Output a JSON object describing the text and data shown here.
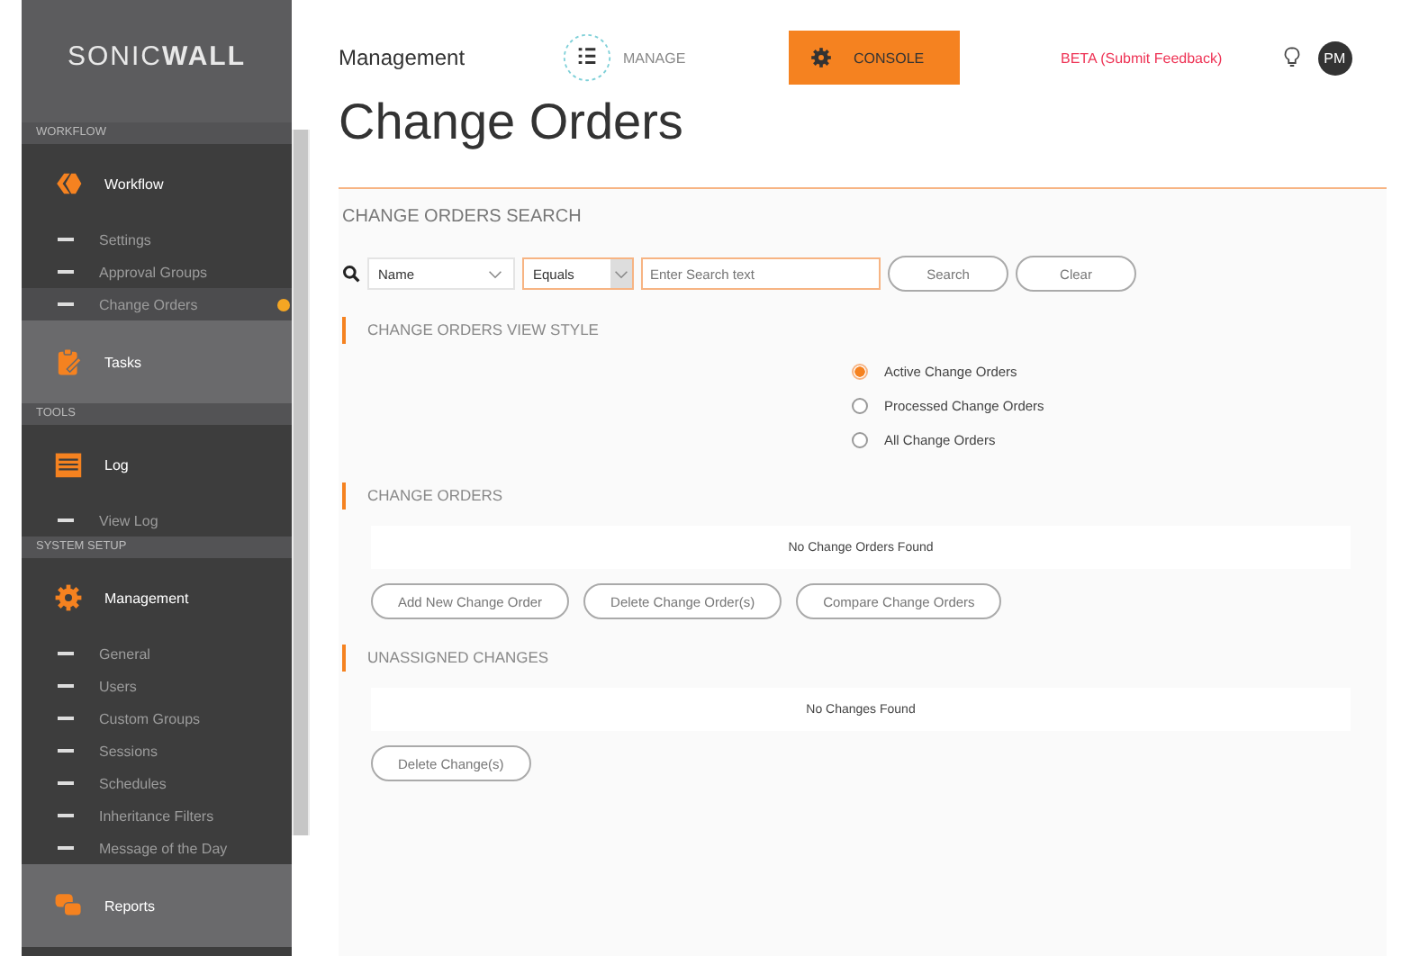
{
  "sidebar": {
    "logo": "SONIC**WALL**",
    "sections": [
      {
        "title": "WORKFLOW",
        "groups": [
          {
            "label": "Workflow",
            "expanded": true,
            "items": [
              {
                "label": "Settings",
                "selected": false
              },
              {
                "label": "Approval Groups",
                "selected": false
              },
              {
                "label": "Change Orders",
                "selected": true
              }
            ]
          },
          {
            "label": "Tasks",
            "expanded": false
          }
        ]
      },
      {
        "title": "TOOLS",
        "groups": [
          {
            "label": "Log",
            "expanded": true,
            "items": [
              {
                "label": "View Log",
                "selected": false
              }
            ]
          }
        ]
      },
      {
        "title": "SYSTEM SETUP",
        "groups": [
          {
            "label": "Management",
            "expanded": true,
            "items": [
              {
                "label": "General",
                "selected": false
              },
              {
                "label": "Users",
                "selected": false
              },
              {
                "label": "Custom Groups",
                "selected": false
              },
              {
                "label": "Sessions",
                "selected": false
              },
              {
                "label": "Schedules",
                "selected": false
              },
              {
                "label": "Inheritance Filters",
                "selected": false
              },
              {
                "label": "Message of the Day",
                "selected": false
              }
            ]
          },
          {
            "label": "Reports",
            "expanded": false
          }
        ]
      }
    ]
  },
  "topbar": {
    "section": "Management",
    "manage": "MANAGE",
    "console": "CONSOLE",
    "beta": "BETA (Submit Feedback)",
    "avatar": "PM"
  },
  "page_title": "Change Orders",
  "search": {
    "heading": "CHANGE ORDERS SEARCH",
    "field": "Name",
    "operator": "Equals",
    "placeholder": "Enter Search text",
    "buttons": [
      "Search",
      "Clear"
    ]
  },
  "view_style": {
    "heading": "CHANGE ORDERS VIEW STYLE",
    "options": [
      {
        "label": "Active Change Orders",
        "selected": true
      },
      {
        "label": "Processed Change Orders",
        "selected": false
      },
      {
        "label": "All Change Orders",
        "selected": false
      }
    ]
  },
  "change_orders": {
    "heading": "CHANGE ORDERS",
    "empty": "No Change Orders Found",
    "buttons": [
      "Add New Change Order",
      "Delete Change Order(s)",
      "Compare Change Orders"
    ]
  },
  "unassigned": {
    "heading": "UNASSIGNED CHANGES",
    "empty": "No Changes Found",
    "buttons": [
      "Delete Change(s)"
    ]
  }
}
